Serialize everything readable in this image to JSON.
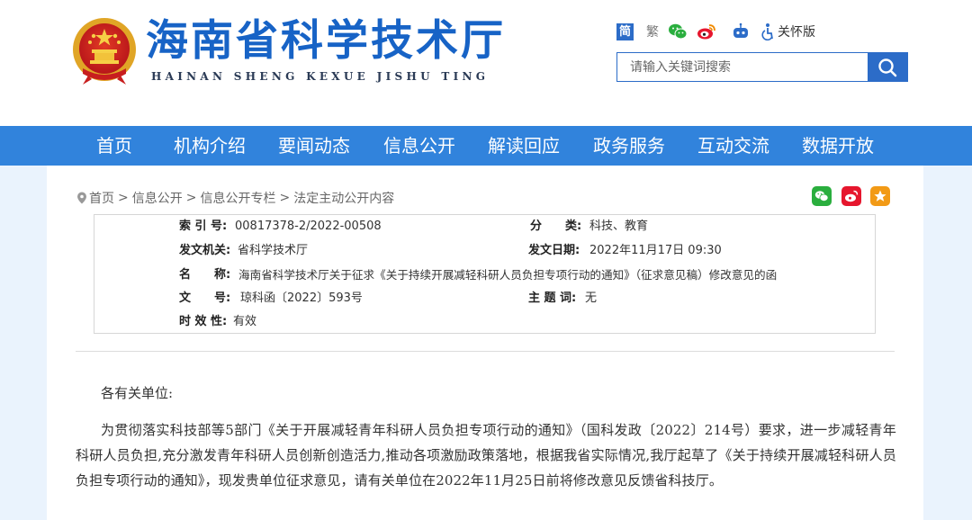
{
  "header": {
    "site_title": "海南省科学技术厅",
    "site_pinyin": "HAINAN SHENG KEXUE JISHU TING",
    "tools": {
      "simplified": "简",
      "traditional": "繁",
      "care_mode": "关怀版"
    },
    "search": {
      "placeholder": "请输入关键词搜索"
    }
  },
  "nav": {
    "items": [
      "首页",
      "机构介绍",
      "要闻动态",
      "信息公开",
      "解读回应",
      "政务服务",
      "互动交流",
      "数据开放"
    ]
  },
  "breadcrumb": {
    "items": [
      "首页",
      "信息公开",
      "信息公开专栏",
      "法定主动公开内容"
    ],
    "separator": ">"
  },
  "meta": {
    "index_label": "索 引 号:",
    "index_value": "00817378-2/2022-00508",
    "category_label": "分　　类:",
    "category_value": "科技、教育",
    "issuer_label": "发文机关:",
    "issuer_value": "省科学技术厅",
    "date_label": "发文日期:",
    "date_value": "2022年11月17日 09:30",
    "name_label": "名　　称:",
    "name_value": "海南省科学技术厅关于征求《关于持续开展减轻科研人员负担专项行动的通知》（征求意见稿）修改意见的函",
    "docno_label": "文　　号:",
    "docno_value": "琼科函〔2022〕593号",
    "topic_label": "主 题 词:",
    "topic_value": "无",
    "validity_label": "时 效 性:",
    "validity_value": "有效"
  },
  "content": {
    "salutation": "各有关单位:",
    "paragraph": "为贯彻落实科技部等5部门《关于开展减轻青年科研人员负担专项行动的通知》（国科发政〔2022〕214号）要求，进一步减轻青年科研人员负担,充分激发青年科研人员创新创造活力,推动各项激励政策落地，根据我省实际情况,我厅起草了《关于持续开展减轻科研人员负担专项行动的通知》，现发贵单位征求意见，请有关单位在2022年11月25日前将修改意见反馈省科技厅。"
  },
  "colors": {
    "brand_blue": "#1763c6",
    "nav_blue": "#3183dc",
    "page_bg": "#eaf3fd"
  },
  "icons": {
    "emblem": "national-emblem",
    "wechat": "wechat-icon",
    "weibo": "weibo-icon",
    "robot": "robot-icon",
    "accessibility": "accessibility-icon",
    "search": "search-icon",
    "location": "location-pin-icon",
    "favorite": "star-icon"
  }
}
